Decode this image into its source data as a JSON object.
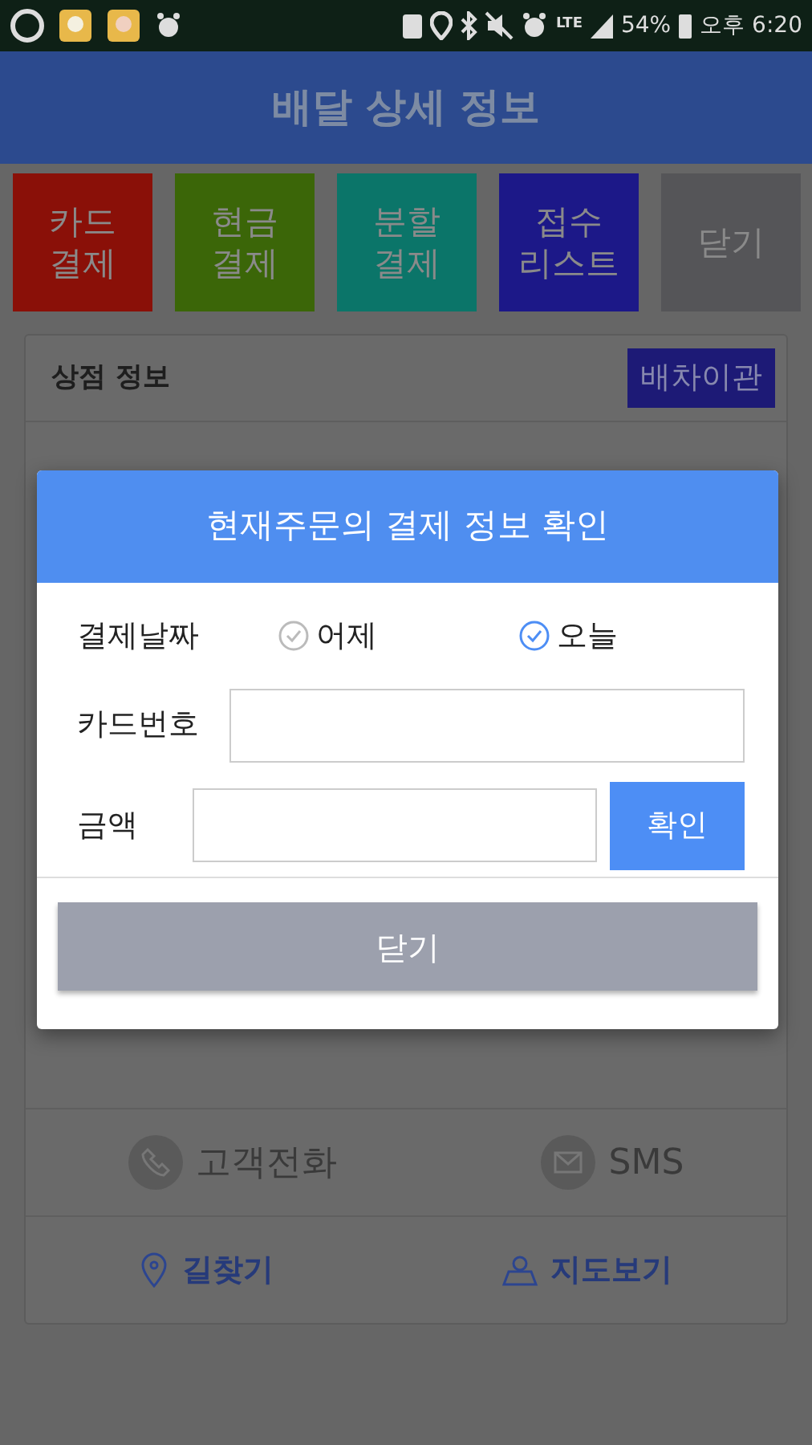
{
  "status_bar": {
    "network": "LTE",
    "battery": "54%",
    "time": "오후 6:20"
  },
  "header": {
    "title": "배달 상세 정보"
  },
  "actions": [
    {
      "lines": [
        "카드",
        "결제"
      ],
      "color": "#8a1008"
    },
    {
      "lines": [
        "현금",
        "결제"
      ],
      "color": "#3b6608"
    },
    {
      "lines": [
        "분할",
        "결제"
      ],
      "color": "#0b7569"
    },
    {
      "lines": [
        "접수",
        "리스트"
      ],
      "color": "#1c1888"
    },
    {
      "lines": [
        "닫기"
      ],
      "color": "#555558"
    }
  ],
  "store_card": {
    "title": "상점 정보",
    "dispatch_button": "배차이관",
    "contact": [
      {
        "kind": "phone",
        "label": "고객전화"
      },
      {
        "kind": "sms",
        "label": "SMS"
      }
    ],
    "map_links": [
      {
        "kind": "route",
        "label": "길찾기"
      },
      {
        "kind": "map",
        "label": "지도보기"
      }
    ]
  },
  "dialog": {
    "title": "현재주문의 결제 정보 확인",
    "date_label": "결제날짜",
    "date_options": [
      {
        "label": "어제",
        "selected": false
      },
      {
        "label": "오늘",
        "selected": true
      }
    ],
    "card_label": "카드번호",
    "amount_label": "금액",
    "confirm": "확인",
    "close": "닫기"
  }
}
